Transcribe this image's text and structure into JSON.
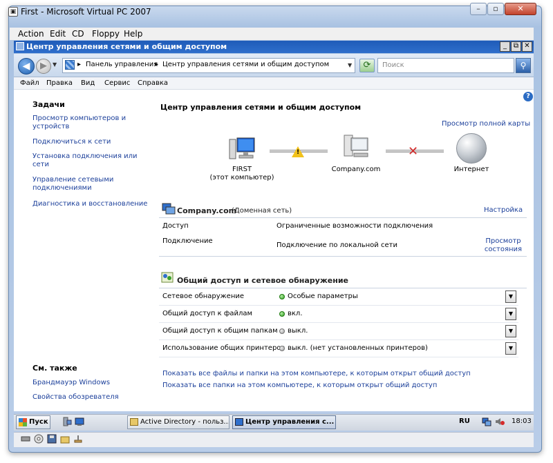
{
  "vpc_window": {
    "title": "First - Microsoft Virtual PC 2007",
    "menu": [
      "Action",
      "Edit",
      "CD",
      "Floppy",
      "Help"
    ]
  },
  "guest_window": {
    "title": "Центр управления сетями и общим доступом",
    "address": {
      "crumbs": [
        "Панель управления",
        "Центр управления сетями и общим доступом"
      ]
    },
    "search_placeholder": "Поиск",
    "menu": [
      "Файл",
      "Правка",
      "Вид",
      "Сервис",
      "Справка"
    ]
  },
  "sidebar": {
    "tasks_heading": "Задачи",
    "tasks": [
      "Просмотр компьютеров и устройств",
      "Подключиться к сети",
      "Установка подключения или сети",
      "Управление сетевыми подключениями",
      "Диагностика и восстановление"
    ],
    "see_also_heading": "См. также",
    "see_also": [
      "Брандмауэр Windows",
      "Свойства обозревателя"
    ]
  },
  "main": {
    "title": "Центр управления сетями и общим доступом",
    "full_map_link": "Просмотр полной карты",
    "map": {
      "computer_name": "FIRST",
      "computer_sub": "(этот компьютер)",
      "network_name": "Company.com",
      "internet_label": "Интернет",
      "status_colors": {
        "warning": "#f2c21b",
        "error": "#d42b2b"
      }
    },
    "network": {
      "name": "Company.com",
      "type": "(Доменная сеть)",
      "customize_link": "Настройка",
      "rows": [
        {
          "label": "Доступ",
          "value": "Ограниченные возможности подключения"
        },
        {
          "label": "Подключение",
          "value": "Подключение по локальной сети"
        }
      ],
      "view_status_link": "Просмотр состояния"
    },
    "sharing": {
      "heading": "Общий доступ и сетевое обнаружение",
      "rows": [
        {
          "label": "Сетевое обнаружение",
          "value": "Особые параметры",
          "status": "green"
        },
        {
          "label": "Общий доступ к файлам",
          "value": "вкл.",
          "status": "green"
        },
        {
          "label": "Общий доступ к общим папкам",
          "value": "выкл.",
          "status": "gray"
        },
        {
          "label": "Использование общих принтеров",
          "value": "выкл. (нет установленных принтеров)",
          "status": "gray"
        }
      ]
    },
    "bottom_links": [
      "Показать все файлы и папки на этом компьютере, к которым открыт общий доступ",
      "Показать все папки на этом компьютере, к которым открыт общий доступ"
    ]
  },
  "taskbar": {
    "start_label": "Пуск",
    "tasks": [
      {
        "label": "Active Directory - польз...",
        "active": false
      },
      {
        "label": "Центр управления с...",
        "active": true
      }
    ],
    "language": "RU",
    "clock": "18:03"
  }
}
